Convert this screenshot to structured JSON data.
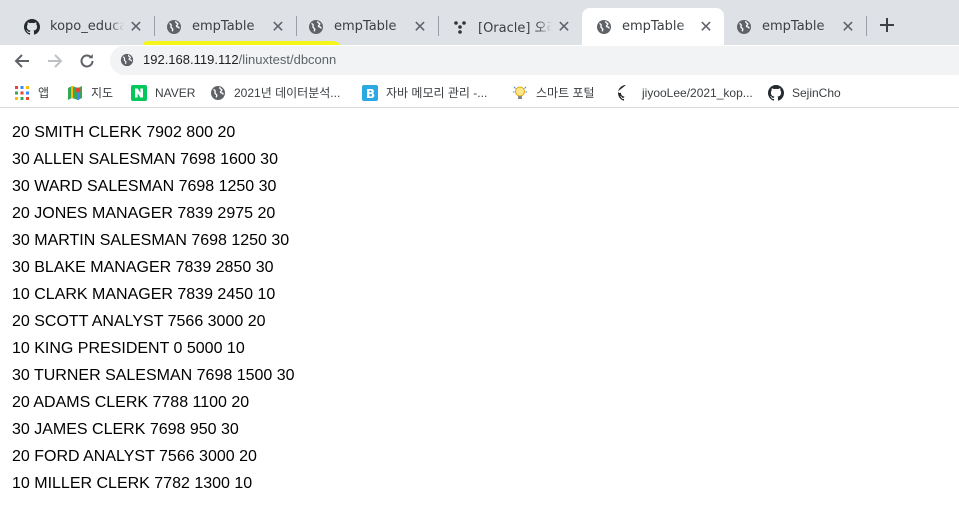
{
  "tabs": [
    {
      "title": "kopo_education",
      "icon": "github-icon"
    },
    {
      "title": "empTable",
      "icon": "globe-icon"
    },
    {
      "title": "empTable",
      "icon": "globe-icon"
    },
    {
      "title": "[Oracle] 오라클",
      "icon": "dots-icon"
    },
    {
      "title": "empTable",
      "icon": "globe-icon",
      "active": true
    },
    {
      "title": "empTable",
      "icon": "globe-icon"
    }
  ],
  "toolbar": {
    "url_host": "192.168.119.112",
    "url_path": "/linuxtest/dbconn"
  },
  "bookmarks": [
    {
      "label": "앱",
      "icon": "apps-grid-icon"
    },
    {
      "label": "지도",
      "icon": "maps-icon"
    },
    {
      "label": "NAVER",
      "icon": "naver-icon"
    },
    {
      "label": "2021년 데이터분석...",
      "icon": "globe-icon"
    },
    {
      "label": "자바 메모리 관리 -...",
      "icon": "blog-icon"
    },
    {
      "label": "스마트 포털",
      "icon": "bulb-icon"
    },
    {
      "label": "jiyooLee/2021_kop...",
      "icon": "github-icon"
    },
    {
      "label": "SejinCho",
      "icon": "github-icon"
    }
  ],
  "rows": [
    "20 SMITH CLERK 7902 800 20",
    "30 ALLEN SALESMAN 7698 1600 30",
    "30 WARD SALESMAN 7698 1250 30",
    "20 JONES MANAGER 7839 2975 20",
    "30 MARTIN SALESMAN 7698 1250 30",
    "30 BLAKE MANAGER 7839 2850 30",
    "10 CLARK MANAGER 7839 2450 10",
    "20 SCOTT ANALYST 7566 3000 20",
    "10 KING PRESIDENT 0 5000 10",
    "30 TURNER SALESMAN 7698 1500 30",
    "20 ADAMS CLERK 7788 1100 20",
    "30 JAMES CLERK 7698 950 30",
    "20 FORD ANALYST 7566 3000 20",
    "10 MILLER CLERK 7782 1300 10"
  ]
}
